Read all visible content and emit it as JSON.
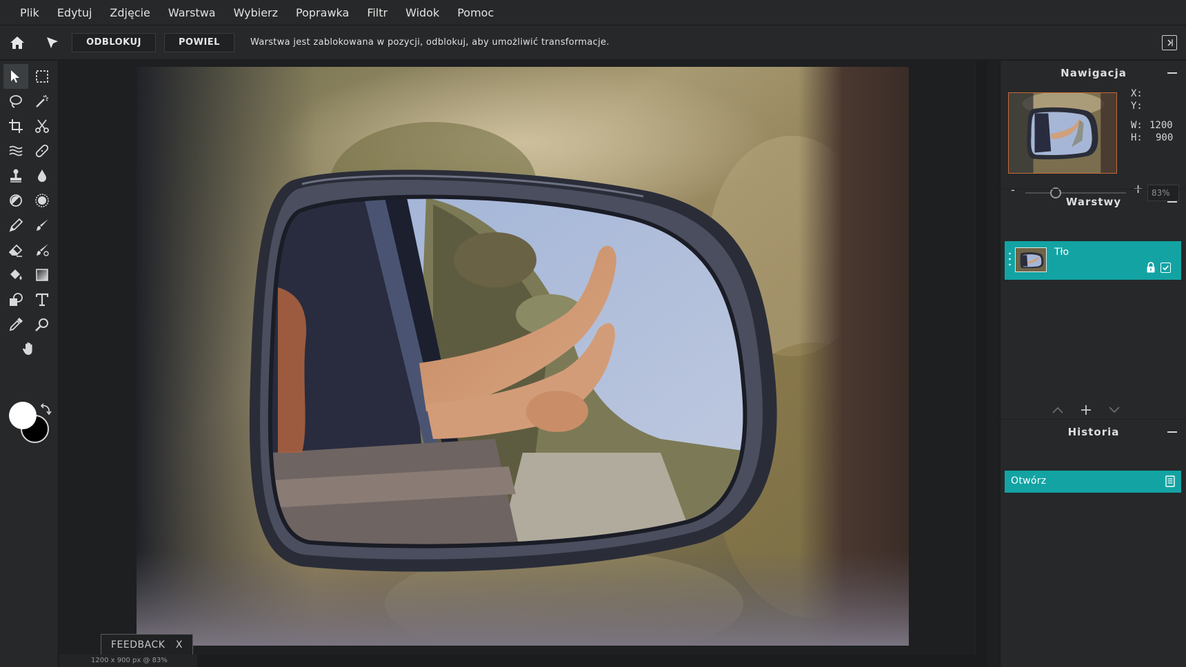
{
  "menu": {
    "items": [
      "Plik",
      "Edytuj",
      "Zdjęcie",
      "Warstwa",
      "Wybierz",
      "Poprawka",
      "Filtr",
      "Widok",
      "Pomoc"
    ]
  },
  "options_bar": {
    "unlock_label": "ODBLOKUJ",
    "duplicate_label": "POWIEL",
    "message": "Warstwa jest zablokowana w pozycji, odblokuj, aby umożliwić transformacje."
  },
  "tools": [
    "move-tool",
    "marquee-tool",
    "lasso-tool",
    "magic-wand-tool",
    "crop-tool",
    "cut-tool",
    "liquify-tool",
    "healing-tool",
    "stamp-tool",
    "blur-tool",
    "dodge-tool",
    "sponge-tool",
    "pencil-tool",
    "brush-tool",
    "eraser-tool",
    "color-replace-tool",
    "bucket-tool",
    "gradient-tool",
    "shape-tool",
    "text-tool",
    "eyedropper-tool",
    "zoom-tool",
    "hand-tool"
  ],
  "colors": {
    "foreground": "#ffffff",
    "background": "#000000",
    "accent": "#13a3a3"
  },
  "status": {
    "size_zoom": "1200 x 900 px @ 83%"
  },
  "feedback": {
    "label": "FEEDBACK",
    "close": "X"
  },
  "navigation": {
    "title": "Nawigacja",
    "x_label": "X:",
    "y_label": "Y:",
    "w_label": "W:",
    "w_value": "1200",
    "h_label": "H:",
    "h_value": "900",
    "zoom_minus": "-",
    "zoom_plus": "+",
    "zoom_value": "83%",
    "zoom_fraction": 0.3
  },
  "layers": {
    "title": "Warstwy",
    "items": [
      {
        "name": "Tło",
        "locked": true,
        "visible": true
      }
    ]
  },
  "history": {
    "title": "Historia",
    "items": [
      {
        "label": "Otwórz"
      }
    ]
  }
}
